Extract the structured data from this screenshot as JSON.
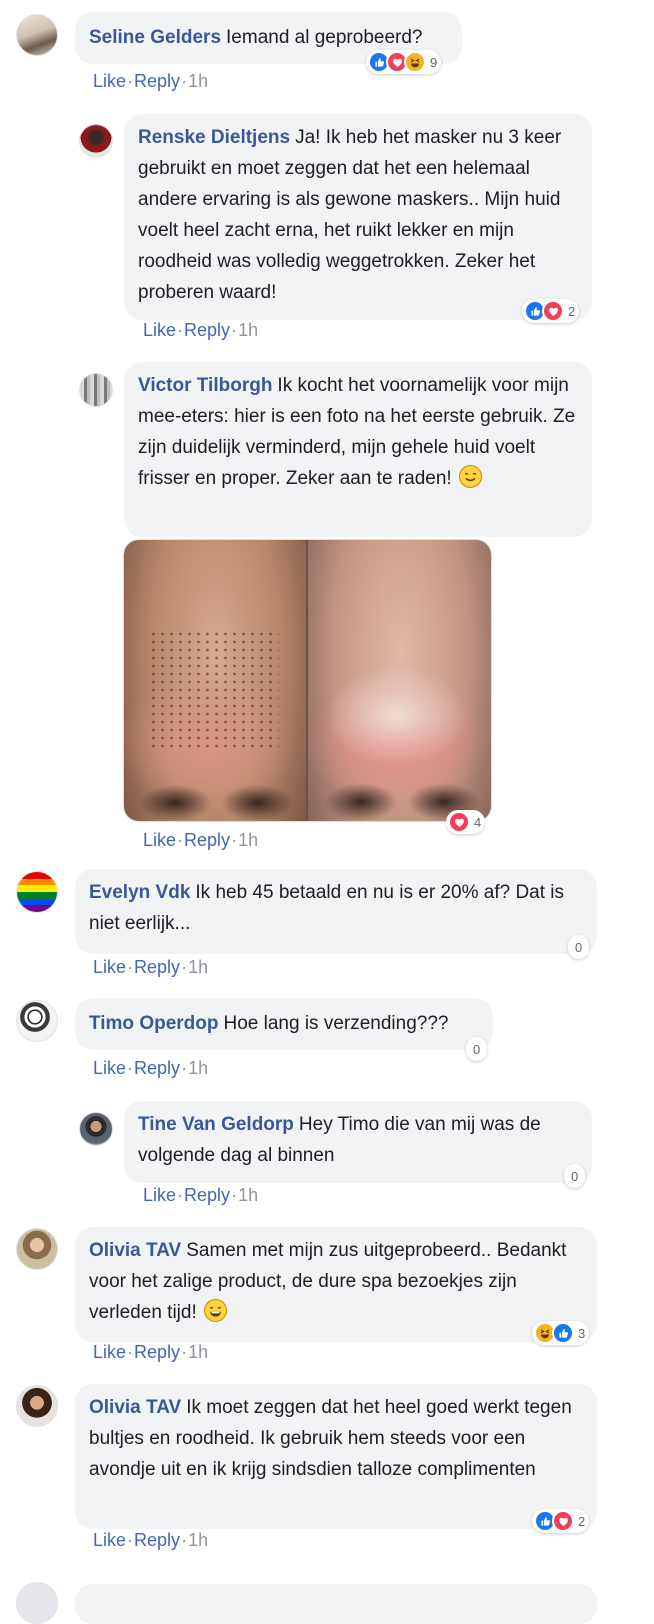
{
  "actions": {
    "like": "Like",
    "reply": "Reply",
    "sep": "·"
  },
  "comments": [
    {
      "author": "Seline Gelders",
      "text": "Iemand al geprobeerd?",
      "reactions": "9",
      "time": "1h"
    },
    {
      "author": "Renske Dieltjens",
      "text": "Ja! Ik heb het masker nu 3 keer gebruikt en moet zeggen dat het een helemaal andere ervaring is als gewone maskers.. Mijn huid voelt heel zacht erna, het ruikt lekker en mijn roodheid was volledig weggetrokken. Zeker het proberen waard!",
      "reactions": "2",
      "time": "1h"
    },
    {
      "author": "Victor Tilborgh",
      "text": "Ik kocht het voornamelijk voor mijn mee-eters: hier is een foto na het eerste gebruik. Ze zijn duidelijk verminderd, mijn gehele huid voelt frisser en proper. Zeker aan te raden!",
      "reactions": "4",
      "time": "1h"
    },
    {
      "author": "Evelyn Vdk",
      "text": "Ik heb 45 betaald en nu is er 20% af? Dat is niet eerlijk...",
      "reactions": "0",
      "time": "1h"
    },
    {
      "author": "Timo Operdop",
      "text": "Hoe lang is verzending???",
      "reactions": "0",
      "time": "1h"
    },
    {
      "author": "Tine Van Geldorp",
      "text": "Hey Timo die van mij was de volgende dag al binnen",
      "reactions": "0",
      "time": "1h"
    },
    {
      "author": "Olivia TAV",
      "text": "Samen met mijn zus uitgeprobeerd.. Bedankt voor het zalige product, de dure spa bezoekjes zijn verleden tijd!",
      "reactions": "3",
      "time": "1h"
    },
    {
      "author": "Olivia TAV",
      "text": "Ik moet zeggen dat het heel goed werkt tegen bultjes en roodheid. Ik gebruik hem steeds voor een avondje uit en ik krijg sindsdien talloze complimenten",
      "reactions": "2",
      "time": "1h"
    }
  ],
  "colors": {
    "link": "#385898",
    "bubble": "#f2f3f5",
    "like": "#1877f2",
    "love": "#f33e58"
  },
  "icons": [
    "like-reaction-icon",
    "love-reaction-icon",
    "haha-reaction-icon",
    "smiling-emoji-icon",
    "grinning-emoji-icon"
  ]
}
